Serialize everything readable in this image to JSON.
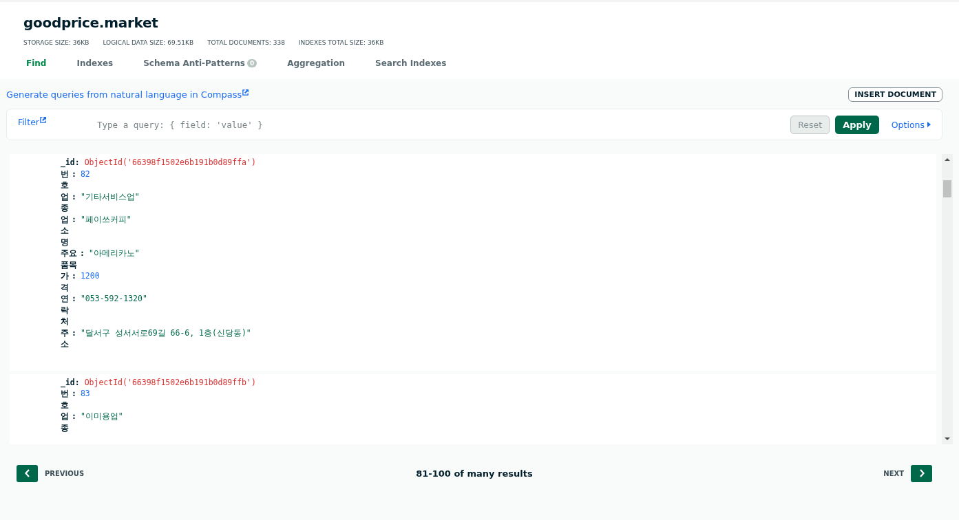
{
  "header": {
    "title": "goodprice.market",
    "stats": [
      {
        "label": "STORAGE SIZE:",
        "value": "36KB"
      },
      {
        "label": "LOGICAL DATA SIZE:",
        "value": "69.51KB"
      },
      {
        "label": "TOTAL DOCUMENTS:",
        "value": "338"
      },
      {
        "label": "INDEXES TOTAL SIZE:",
        "value": "36KB"
      }
    ]
  },
  "tabs": [
    {
      "label": "Find",
      "selected": true
    },
    {
      "label": "Indexes",
      "selected": false
    },
    {
      "label": "Schema Anti-Patterns",
      "badge": "0",
      "selected": false
    },
    {
      "label": "Aggregation",
      "selected": false
    },
    {
      "label": "Search Indexes",
      "selected": false
    }
  ],
  "toolbar": {
    "compass_link": "Generate queries from natural language in Compass",
    "insert_button": "INSERT DOCUMENT"
  },
  "filter": {
    "label": "Filter",
    "placeholder": "Type a query: { field: 'value' }",
    "reset": "Reset",
    "apply": "Apply",
    "options": "Options"
  },
  "documents": [
    {
      "id_key": "_id:",
      "id_value": "ObjectId('66398f1502e6b191b0d89ffa')",
      "fields": [
        {
          "key": "번호",
          "sep": ":",
          "value": "82",
          "kind": "number"
        },
        {
          "key": "업종",
          "sep": ":",
          "value": "\"기타서비스업\"",
          "kind": "string"
        },
        {
          "key": "업소명",
          "sep": ":",
          "value": "\"페이쓰커피\"",
          "kind": "string"
        },
        {
          "key": "주요품목",
          "sep": ":",
          "value": "\"아메리카노\"",
          "kind": "string"
        },
        {
          "key": "가격",
          "sep": ":",
          "value": "1200",
          "kind": "number"
        },
        {
          "key": "연락처",
          "sep": ":",
          "value": "\"053-592-1320\"",
          "kind": "string"
        },
        {
          "key": "주소",
          "sep": ":",
          "value": "\"달서구 성서서로69길 66-6, 1층(신당동)\"",
          "kind": "string"
        }
      ]
    },
    {
      "id_key": "_id:",
      "id_value": "ObjectId('66398f1502e6b191b0d89ffb')",
      "fields": [
        {
          "key": "번호",
          "sep": ":",
          "value": "83",
          "kind": "number"
        },
        {
          "key": "업종",
          "sep": ":",
          "value": "\"이미용업\"",
          "kind": "string"
        }
      ]
    }
  ],
  "pagination": {
    "previous": "PREVIOUS",
    "summary": "81-100 of many results",
    "next": "NEXT"
  }
}
